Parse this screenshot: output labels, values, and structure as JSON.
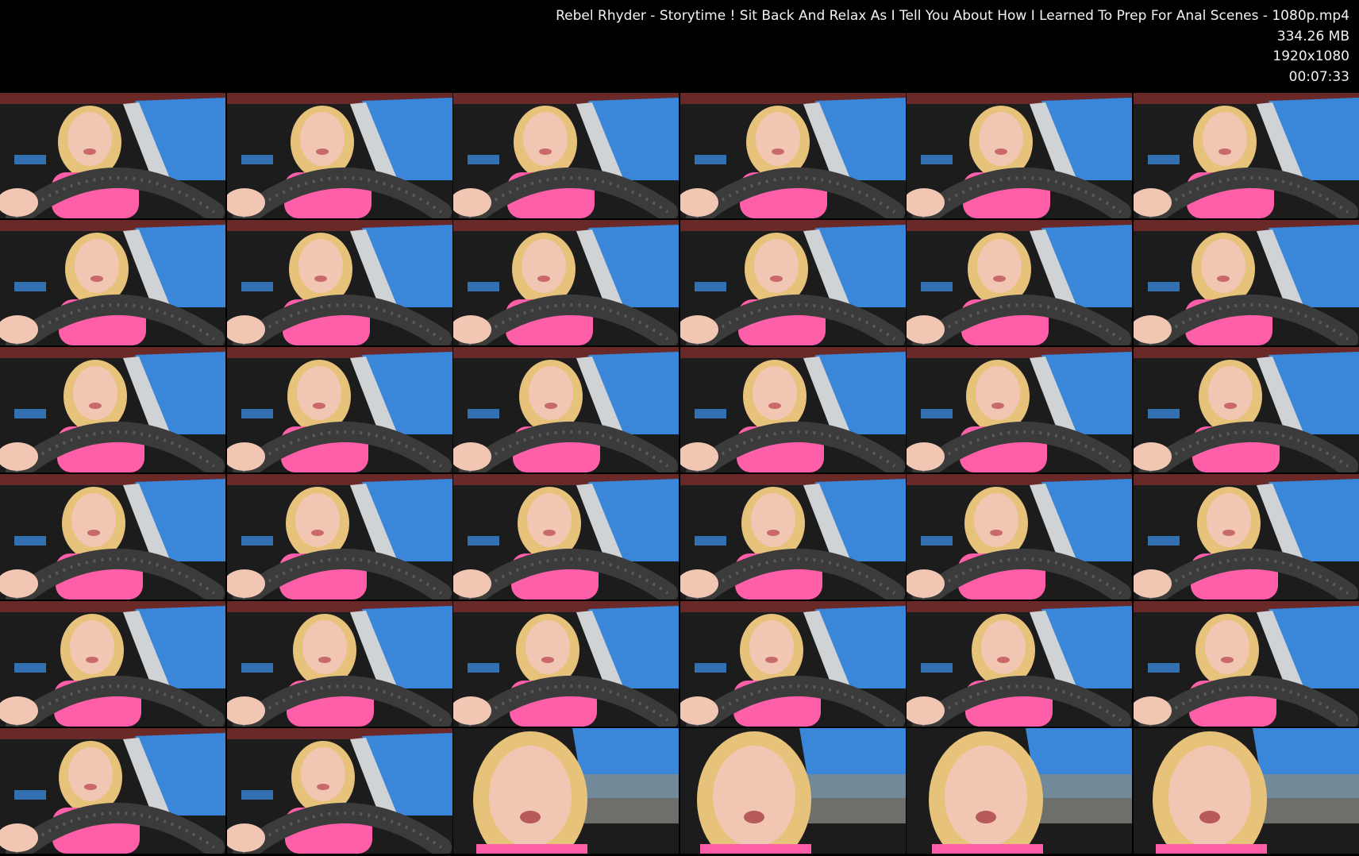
{
  "file": {
    "name": "Rebel Rhyder - Storytime ! Sit Back And Relax As I Tell You About How I Learned To Prep For Anal Scenes - 1080p.mp4",
    "size": "334.26 MB",
    "resolution": "1920x1080",
    "duration": "00:07:33"
  },
  "colors": {
    "background": "#000000",
    "text": "#f2f2f2",
    "sky": "#3a86d8",
    "interior": "#1c1c1c",
    "wheel": "#3b3b3b",
    "skin": "#f1c7b3",
    "hair": "#e6c27a",
    "shirt": "#ff5fa8",
    "roof_red": "#8b2f2f"
  },
  "thumbnails": {
    "count": 36,
    "columns": 6,
    "rows": 6
  }
}
